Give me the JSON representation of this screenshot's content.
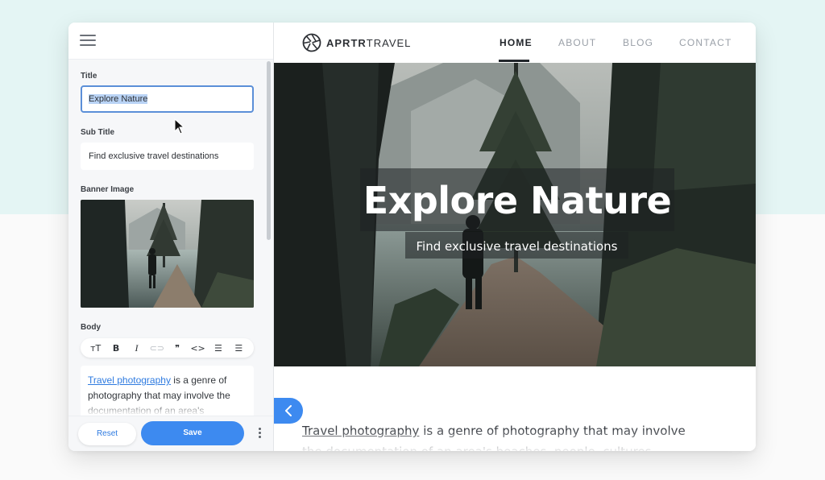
{
  "editor": {
    "fields": {
      "title_label": "Title",
      "title_value": "Explore Nature",
      "subtitle_label": "Sub Title",
      "subtitle_value": "Find exclusive travel destinations",
      "banner_label": "Banner Image",
      "body_label": "Body"
    },
    "toolbar": [
      {
        "icon": "text-size-icon",
        "glyph": "тT"
      },
      {
        "icon": "bold-icon",
        "glyph": "B"
      },
      {
        "icon": "italic-icon",
        "glyph": "I"
      },
      {
        "icon": "link-icon",
        "glyph": "⊂⊃"
      },
      {
        "icon": "quote-icon",
        "glyph": "❞"
      },
      {
        "icon": "code-icon",
        "glyph": "<>"
      },
      {
        "icon": "bulleted-list-icon",
        "glyph": "☰"
      },
      {
        "icon": "numbered-list-icon",
        "glyph": "☰"
      }
    ],
    "body_link_text": "Travel photography",
    "body_rest_text": " is a genre of photography that may involve the documentation of an area's",
    "reset_label": "Reset",
    "save_label": "Save"
  },
  "site": {
    "logo_bold": "APRTR",
    "logo_thin": "TRAVEL",
    "nav": [
      "HOME",
      "ABOUT",
      "BLOG",
      "CONTACT"
    ],
    "active_nav": "HOME",
    "hero_title": "Explore Nature",
    "hero_subtitle": "Find exclusive travel destinations",
    "body_link_text": "Travel photography",
    "body_rest_text": " is a genre of photography that may involve the documentation of an area's beaches, people, cultures, customs and"
  },
  "colors": {
    "accent": "#3d8af0",
    "link": "#2f7be0",
    "page_top": "#e4f5f4"
  }
}
